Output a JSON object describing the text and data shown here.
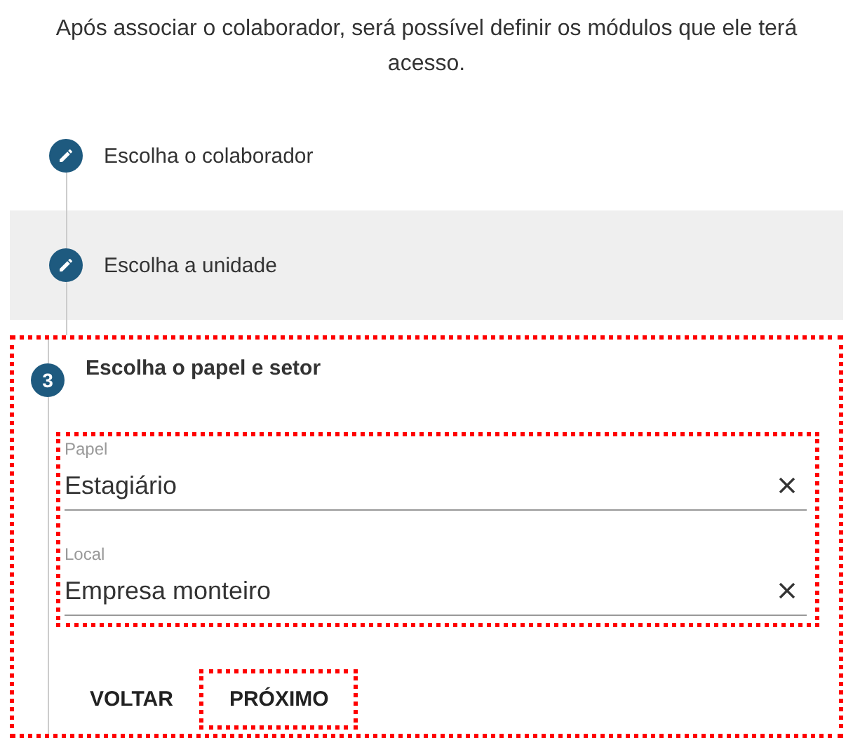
{
  "intro": "Após associar o colaborador, será possível definir os módulos que ele terá acesso.",
  "steps": [
    {
      "kind": "done",
      "label": "Escolha o colaborador",
      "highlighted": false,
      "annotated": false
    },
    {
      "kind": "done",
      "label": "Escolha a unidade",
      "highlighted": true,
      "annotated": false
    },
    {
      "kind": "active",
      "number": "3",
      "label": "Escolha o papel e setor",
      "highlighted": false,
      "annotated": true,
      "fields_annotated": true,
      "fields": [
        {
          "label": "Papel",
          "value": "Estagiário"
        },
        {
          "label": "Local",
          "value": "Empresa monteiro"
        }
      ],
      "buttons": [
        {
          "label": "VOLTAR",
          "annotated": false
        },
        {
          "label": "PRÓXIMO",
          "annotated": true
        }
      ]
    }
  ]
}
